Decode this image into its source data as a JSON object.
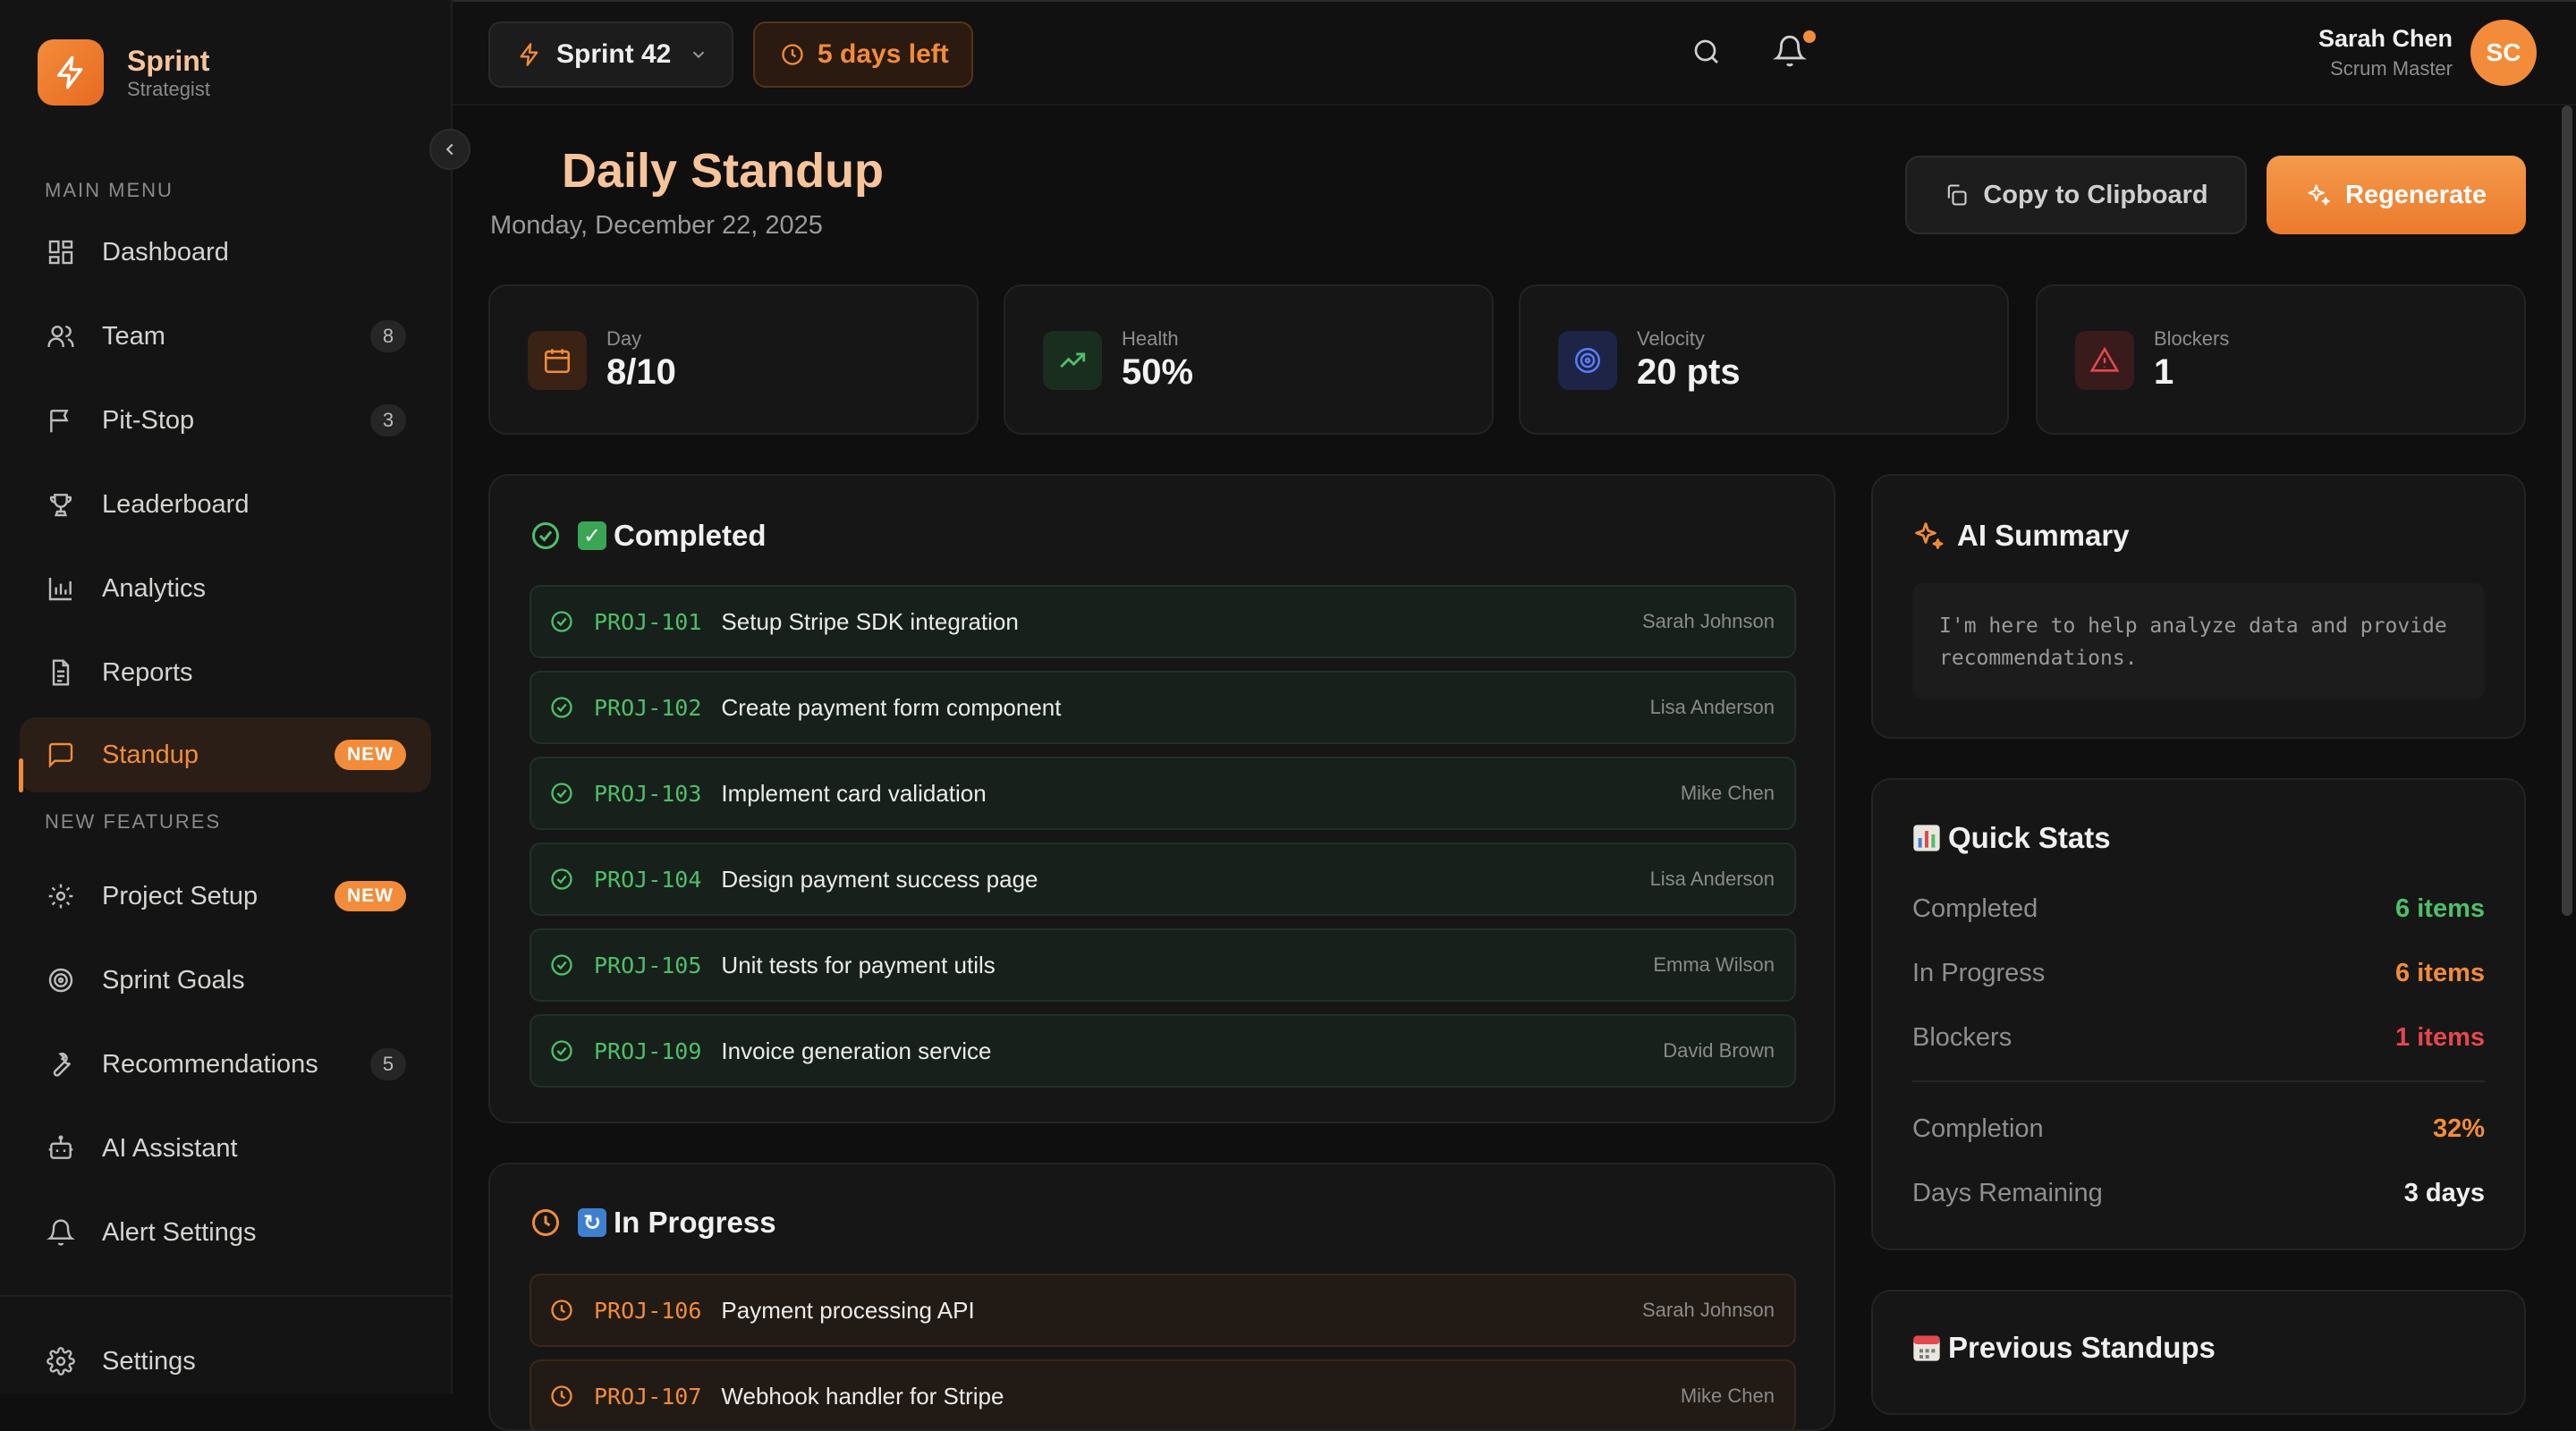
{
  "brand": {
    "name": "Sprint",
    "subtitle": "Strategist"
  },
  "sidebar": {
    "main_menu_label": "MAIN MENU",
    "new_features_label": "NEW FEATURES",
    "items": [
      {
        "label": "Dashboard",
        "icon": "dashboard-icon"
      },
      {
        "label": "Team",
        "icon": "users-icon",
        "count": "8"
      },
      {
        "label": "Pit-Stop",
        "icon": "flag-icon",
        "count": "3"
      },
      {
        "label": "Leaderboard",
        "icon": "trophy-icon"
      },
      {
        "label": "Analytics",
        "icon": "bar-chart-icon"
      },
      {
        "label": "Reports",
        "icon": "file-text-icon"
      },
      {
        "label": "Standup",
        "icon": "message-square-icon",
        "badge": "NEW",
        "active": true
      }
    ],
    "feature_items": [
      {
        "label": "Project Setup",
        "icon": "settings-icon",
        "badge": "NEW"
      },
      {
        "label": "Sprint Goals",
        "icon": "target-icon"
      },
      {
        "label": "Recommendations",
        "icon": "wrench-icon",
        "count": "5"
      },
      {
        "label": "AI Assistant",
        "icon": "bot-icon"
      },
      {
        "label": "Alert Settings",
        "icon": "bell-icon"
      }
    ],
    "settings_label": "Settings"
  },
  "topbar": {
    "sprint_label": "Sprint 42",
    "days_left": "5 days left",
    "user_name": "Sarah Chen",
    "user_role": "Scrum Master",
    "avatar_initials": "SC"
  },
  "header": {
    "title": "Daily Standup",
    "date": "Monday, December 22, 2025",
    "copy_label": "Copy to Clipboard",
    "regenerate_label": "Regenerate"
  },
  "stats": [
    {
      "label": "Day",
      "value": "8/10",
      "icon": "calendar-icon",
      "color": "#f28c3a"
    },
    {
      "label": "Health",
      "value": "50%",
      "icon": "trending-up-icon",
      "color": "#4fbf6a"
    },
    {
      "label": "Velocity",
      "value": "20 pts",
      "icon": "target-icon",
      "color": "#5b7cf5"
    },
    {
      "label": "Blockers",
      "value": "1",
      "icon": "alert-triangle-icon",
      "color": "#e5484d"
    }
  ],
  "completed": {
    "title": "Completed",
    "tasks": [
      {
        "key": "PROJ-101",
        "title": "Setup Stripe SDK integration",
        "assignee": "Sarah Johnson"
      },
      {
        "key": "PROJ-102",
        "title": "Create payment form component",
        "assignee": "Lisa Anderson"
      },
      {
        "key": "PROJ-103",
        "title": "Implement card validation",
        "assignee": "Mike Chen"
      },
      {
        "key": "PROJ-104",
        "title": "Design payment success page",
        "assignee": "Lisa Anderson"
      },
      {
        "key": "PROJ-105",
        "title": "Unit tests for payment utils",
        "assignee": "Emma Wilson"
      },
      {
        "key": "PROJ-109",
        "title": "Invoice generation service",
        "assignee": "David Brown"
      }
    ]
  },
  "in_progress": {
    "title": "In Progress",
    "tasks": [
      {
        "key": "PROJ-106",
        "title": "Payment processing API",
        "assignee": "Sarah Johnson"
      },
      {
        "key": "PROJ-107",
        "title": "Webhook handler for Stripe",
        "assignee": "Mike Chen"
      }
    ]
  },
  "ai_summary": {
    "title": "AI Summary",
    "text": "I'm here to help analyze data and provide recommendations."
  },
  "quick_stats": {
    "title": "Quick Stats",
    "rows": [
      {
        "label": "Completed",
        "value": "6 items",
        "color": "#4fbf6a"
      },
      {
        "label": "In Progress",
        "value": "6 items",
        "color": "#f28c3a"
      },
      {
        "label": "Blockers",
        "value": "1 items",
        "color": "#e5484d"
      },
      {
        "label": "Completion",
        "value": "32%",
        "color": "#f28c3a"
      },
      {
        "label": "Days Remaining",
        "value": "3 days",
        "color": "#f0f0f0"
      }
    ]
  },
  "previous_standups": {
    "title": "Previous Standups"
  }
}
